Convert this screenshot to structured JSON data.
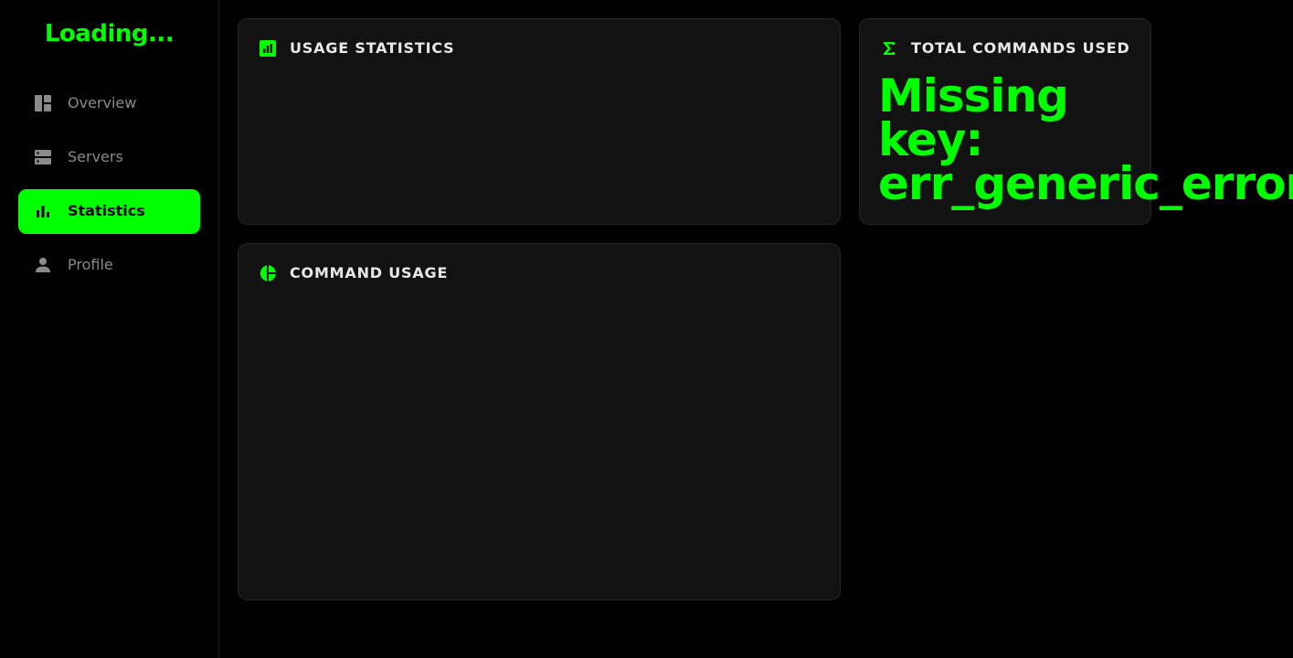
{
  "sidebar": {
    "brand": "Loading...",
    "items": [
      {
        "label": "Overview",
        "icon": "dashboard-icon",
        "active": false
      },
      {
        "label": "Servers",
        "icon": "servers-icon",
        "active": false
      },
      {
        "label": "Statistics",
        "icon": "bar-chart-icon",
        "active": true
      },
      {
        "label": "Profile",
        "icon": "person-icon",
        "active": false
      }
    ]
  },
  "cards": {
    "usage_statistics": {
      "title": "USAGE STATISTICS",
      "icon": "analytics-icon"
    },
    "total_commands": {
      "title": "TOTAL COMMANDS USED",
      "icon": "sigma-icon",
      "value_lines": [
        "Missing",
        "key:",
        "err_generic_error"
      ]
    },
    "command_usage": {
      "title": "COMMAND USAGE",
      "icon": "pie-chart-icon"
    }
  },
  "colors": {
    "accent": "#00ff00",
    "background": "#000000",
    "card": "#121212",
    "muted_text": "#8a8a8a"
  }
}
